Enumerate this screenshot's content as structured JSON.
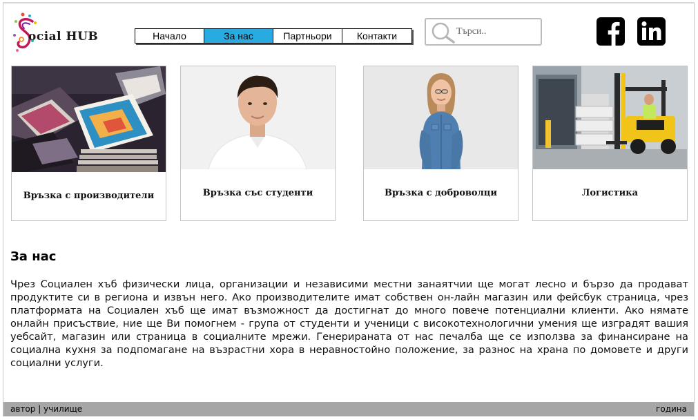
{
  "brand": {
    "logo_text": "ocial HUB"
  },
  "nav": {
    "items": [
      {
        "label": "Начало",
        "active": false
      },
      {
        "label": "За нас",
        "active": true
      },
      {
        "label": "Партньори",
        "active": false
      },
      {
        "label": "Контакти",
        "active": false
      }
    ],
    "active_color": "#29abe2"
  },
  "search": {
    "placeholder": "Търси..",
    "icon": "magnifier-icon"
  },
  "social": [
    {
      "icon": "facebook-icon"
    },
    {
      "icon": "linkedin-icon"
    }
  ],
  "cards": [
    {
      "label": "Връзка с производители",
      "image": "magazines-stack-photo"
    },
    {
      "label": "Връзка със студенти",
      "image": "young-man-portrait-photo"
    },
    {
      "label": "Връзка с доброволци",
      "image": "young-woman-denim-photo"
    },
    {
      "label": "Логистика",
      "image": "forklift-warehouse-photo"
    }
  ],
  "about": {
    "title": "За нас",
    "body": "Чрез Социален хъб физически лица, организации и независими местни занаятчии ще могат лесно и бързо да продават продуктите си в региона и извън него. Ако производителите имат собствен он-лайн магазин или фейсбук страница, чрез платформата на Социален хъб ще имат възможност да достигнат до много повече потенциални клиенти. Ако нямате онлайн присъствие, ние ще Ви помогнем - група от студенти и ученици с високотехнологични умения ще изградят вашия уебсайт, магазин или страница в социалните мрежи. Генерираната от нас печалба ще се използва за финансиране на социална кухня за подпомагане на възрастни хора в неравностойно положение, за разнос на храна по домовете и други социални услуги."
  },
  "footer": {
    "left": "автор | училище",
    "right": "година"
  }
}
